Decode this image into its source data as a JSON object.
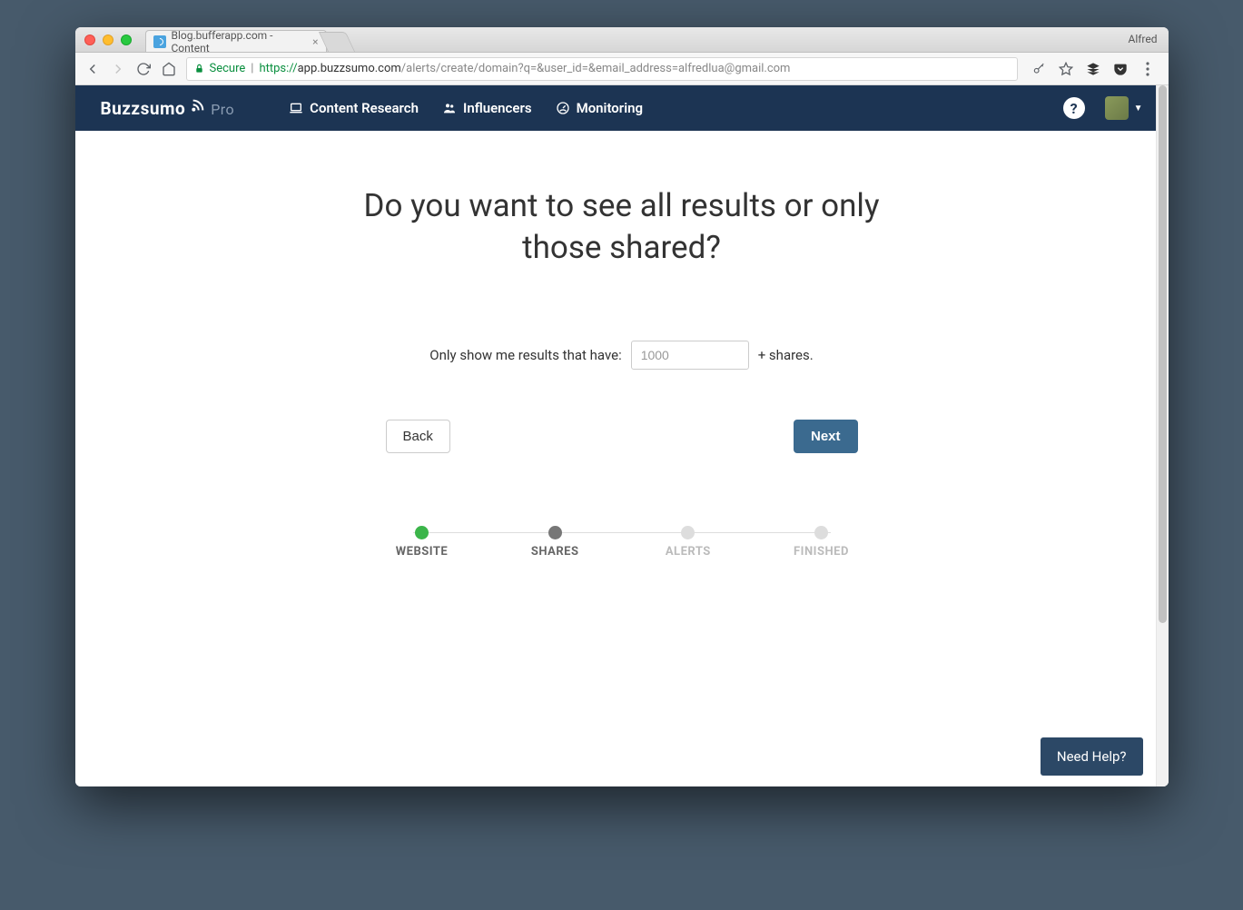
{
  "browser": {
    "tab_title": "Blog.bufferapp.com - Content",
    "user_name": "Alfred",
    "secure_label": "Secure",
    "url_proto": "https://",
    "url_domain": "app.buzzsumo.com",
    "url_path": "/alerts/create/domain?q=&user_id=&email_address=alfredlua@gmail.com"
  },
  "nav": {
    "brand": "Buzzsumo",
    "brand_suffix": "Pro",
    "items": [
      {
        "label": "Content Research"
      },
      {
        "label": "Influencers"
      },
      {
        "label": "Monitoring"
      }
    ]
  },
  "page": {
    "heading": "Do you want to see all results or only those shared?",
    "prompt_prefix": "Only show me results that have:",
    "prompt_suffix": "+ shares.",
    "input_placeholder": "1000",
    "back_label": "Back",
    "next_label": "Next",
    "steps": [
      {
        "label": "WEBSITE",
        "state": "done"
      },
      {
        "label": "SHARES",
        "state": "current"
      },
      {
        "label": "ALERTS",
        "state": "pending"
      },
      {
        "label": "FINISHED",
        "state": "pending"
      }
    ],
    "help_label": "Need Help?"
  }
}
